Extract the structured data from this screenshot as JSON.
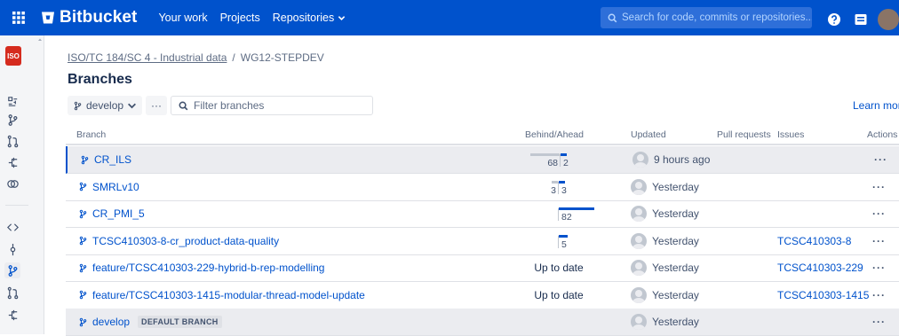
{
  "topnav": {
    "brand": "Bitbucket",
    "links": [
      "Your work",
      "Projects",
      "Repositories"
    ],
    "search_placeholder": "Search for code, commits or repositories..."
  },
  "sidebar": {
    "logo_text": "ISO",
    "icons": [
      "deploy-icon",
      "branch-icon",
      "pull-request-icon",
      "pipeline-icon",
      "integrations-icon",
      "source-icon",
      "commits-icon",
      "branches-icon",
      "pull-requests-icon",
      "pipelines-icon"
    ]
  },
  "breadcrumb": {
    "project": "ISO/TC 184/SC 4 - Industrial data",
    "separator": "/",
    "repo": "WG12-STEPDEV"
  },
  "page": {
    "title": "Branches",
    "branch_select": "develop",
    "more_label": "···",
    "filter_placeholder": "Filter branches",
    "learn_more": "Learn more"
  },
  "table": {
    "headers": {
      "branch": "Branch",
      "behind_ahead": "Behind/Ahead",
      "updated": "Updated",
      "pull_requests": "Pull requests",
      "issues": "Issues",
      "actions": "Actions"
    },
    "rows": [
      {
        "name": "CR_ILS",
        "behind": "68",
        "ahead": "2",
        "behind_frac": 0.83,
        "ahead_frac": 0.18,
        "updated": "9 hours ago",
        "issue": "",
        "actions": "···",
        "selected": true
      },
      {
        "name": "SMRLv10",
        "behind": "3",
        "ahead": "3",
        "behind_frac": 0.18,
        "ahead_frac": 0.18,
        "updated": "Yesterday",
        "issue": "",
        "actions": "···"
      },
      {
        "name": "CR_PMI_5",
        "behind": "",
        "ahead": "82",
        "behind_frac": 0,
        "ahead_frac": 1.0,
        "updated": "Yesterday",
        "issue": "",
        "actions": "···"
      },
      {
        "name": "TCSC410303-8-cr_product-data-quality",
        "behind": "",
        "ahead": "5",
        "behind_frac": 0,
        "ahead_frac": 0.25,
        "updated": "Yesterday",
        "issue": "TCSC410303-8",
        "actions": "···"
      },
      {
        "name": "feature/TCSC410303-229-hybrid-b-rep-modelling",
        "status": "Up to date",
        "updated": "Yesterday",
        "issue": "TCSC410303-229",
        "actions": "···"
      },
      {
        "name": "feature/TCSC410303-1415-modular-thread-model-update",
        "status": "Up to date",
        "updated": "Yesterday",
        "issue": "TCSC410303-1415",
        "actions": "···"
      },
      {
        "name": "develop",
        "lozenge": "DEFAULT BRANCH",
        "updated": "Yesterday",
        "issue": "",
        "actions": "···",
        "default": true
      }
    ]
  }
}
